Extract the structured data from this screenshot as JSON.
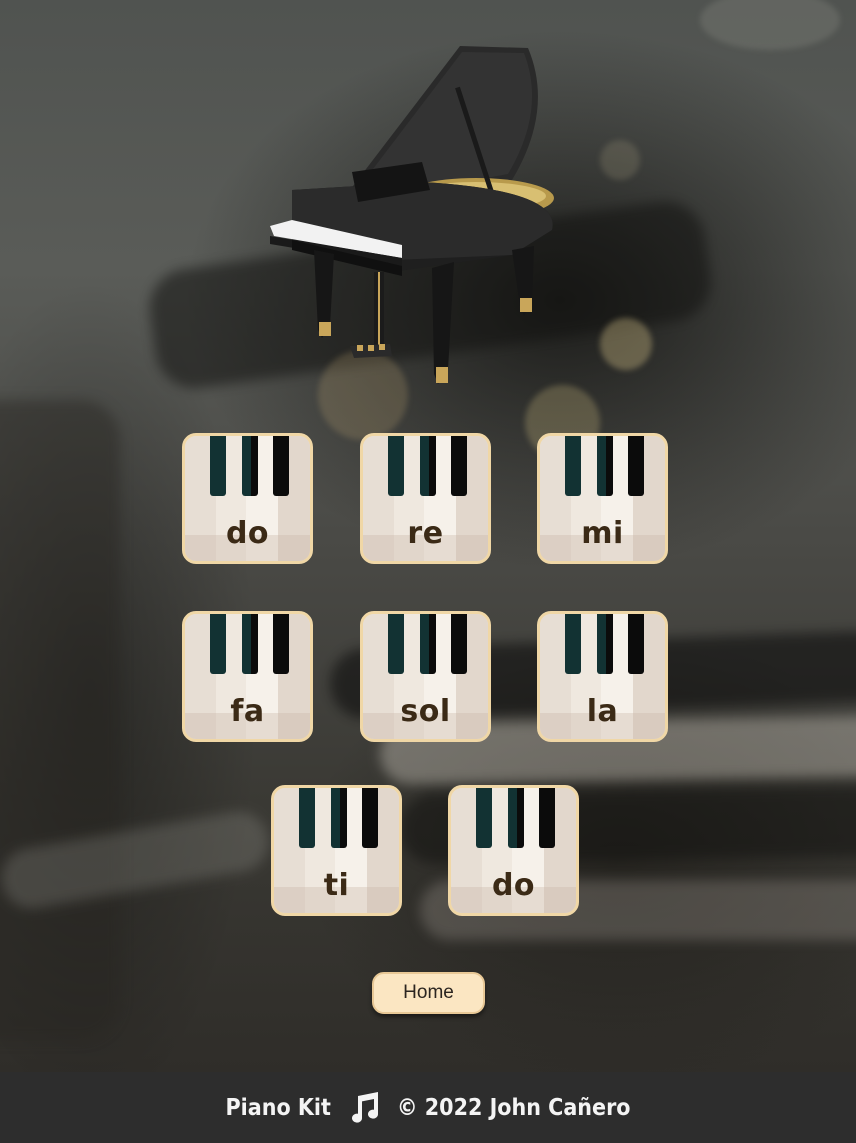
{
  "keys": [
    {
      "label": "do"
    },
    {
      "label": "re"
    },
    {
      "label": "mi"
    },
    {
      "label": "fa"
    },
    {
      "label": "sol"
    },
    {
      "label": "la"
    },
    {
      "label": "ti"
    },
    {
      "label": "do"
    }
  ],
  "home_button": {
    "label": "Home"
  },
  "footer": {
    "brand": "Piano Kit",
    "icon": "music-note-icon",
    "copyright": "© 2022 John Cañero"
  },
  "colors": {
    "key_border": "#f0d7a6",
    "home_button_bg": "#fbe6c2",
    "footer_bg": "#2d2d2d",
    "label_text": "#3b2a16"
  }
}
